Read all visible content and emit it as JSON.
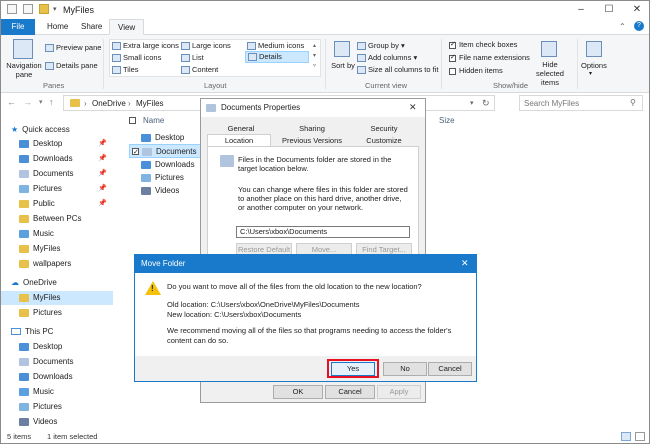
{
  "window": {
    "title": "MyFiles"
  },
  "tabs": [
    "File",
    "Home",
    "Share",
    "View"
  ],
  "ribbon": {
    "panes": {
      "navigation_pane": "Navigation pane",
      "preview_pane": "Preview pane",
      "details_pane": "Details pane",
      "label": "Panes"
    },
    "layout": {
      "items": [
        "Extra large icons",
        "Large icons",
        "Medium icons",
        "Small icons",
        "List",
        "Details",
        "Tiles",
        "Content"
      ],
      "label": "Layout"
    },
    "current_view": {
      "sort_by": "Sort by",
      "group_by": "Group by",
      "add_columns": "Add columns",
      "size_all_columns": "Size all columns to fit",
      "label": "Current view"
    },
    "show_hide": {
      "item_check_boxes": "Item check boxes",
      "file_name_extensions": "File name extensions",
      "hidden_items": "Hidden items",
      "hide_selected": "Hide selected items",
      "label": "Show/hide"
    },
    "options": "Options"
  },
  "address": {
    "path": [
      "OneDrive",
      "MyFiles"
    ],
    "search_placeholder": "Search MyFiles"
  },
  "nav": {
    "quick_access": "Quick access",
    "quick_items": [
      "Desktop",
      "Downloads",
      "Documents",
      "Pictures",
      "Public",
      "Between PCs",
      "Music",
      "MyFiles",
      "wallpapers"
    ],
    "onedrive": "OneDrive",
    "onedrive_items": [
      "MyFiles",
      "Pictures"
    ],
    "this_pc": "This PC",
    "pc_items": [
      "Desktop",
      "Documents",
      "Downloads",
      "Music",
      "Pictures",
      "Videos"
    ]
  },
  "columns": {
    "name": "Name",
    "size": "Size"
  },
  "files": [
    "Desktop",
    "Documents",
    "Downloads",
    "Pictures",
    "Videos"
  ],
  "status": {
    "items": "5 items",
    "selected": "1 item selected"
  },
  "props": {
    "title": "Documents Properties",
    "tabs_row1": [
      "General",
      "Sharing",
      "Security"
    ],
    "tabs_row2": [
      "Location",
      "Previous Versions",
      "Customize"
    ],
    "text1": "Files in the Documents folder are stored in the target location below.",
    "text2": "You can change where files in this folder are stored to another place on this hard drive, another drive, or another computer on your network.",
    "path": "C:\\Users\\xbox\\Documents",
    "restore": "Restore Default",
    "move": "Move...",
    "find_target": "Find Target...",
    "ok": "OK",
    "cancel": "Cancel",
    "apply": "Apply"
  },
  "move": {
    "title": "Move Folder",
    "question": "Do you want to move all of the files from the old location to the new location?",
    "old": "Old location: C:\\Users\\xbox\\OneDrive\\MyFiles\\Documents",
    "new": "New location: C:\\Users\\xbox\\Documents",
    "rec": "We recommend moving all of the files so that programs needing to access the folder's content can do so.",
    "yes": "Yes",
    "no": "No",
    "cancel": "Cancel"
  },
  "colors": {
    "accent": "#1979ca",
    "highlight": "#e81123",
    "selection": "#cce8ff"
  }
}
